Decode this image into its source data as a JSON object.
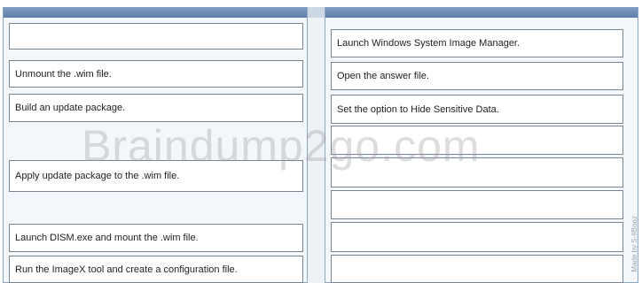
{
  "left_panel": {
    "items": [
      "Unmount the .wim file.",
      "Build an update package.",
      "Apply update package to the .wim file.",
      "Launch DISM.exe and mount the .wim file.",
      "Run the ImageX tool and create a configuration file."
    ]
  },
  "right_panel": {
    "items": [
      "Launch Windows System Image Manager.",
      "Open the answer file.",
      "Set the option to Hide Sensitive Data.",
      "",
      "",
      "",
      "",
      ""
    ]
  },
  "watermark": "Braindump2go.com",
  "side_credit": "Made by S-IIBooz",
  "colors": {
    "header": "#6f8fb8",
    "panel_bg": "#f3f6fa",
    "slot_border": "#7a8592"
  }
}
